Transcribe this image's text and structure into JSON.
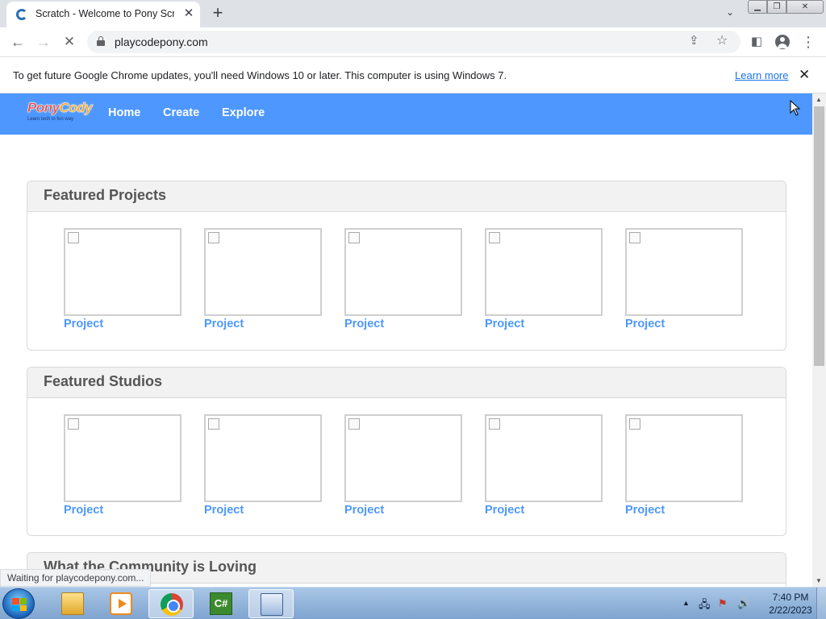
{
  "browser": {
    "tab_title": "Scratch - Welcome to Pony Scrat",
    "url": "playcodepony.com",
    "infobar_text": "To get future Google Chrome updates, you'll need Windows 10 or later. This computer is using Windows 7.",
    "infobar_link": "Learn more",
    "status_text": "Waiting for playcodepony.com..."
  },
  "site": {
    "logo_primary": "Pony",
    "logo_secondary": "Cody",
    "logo_tagline": "Learn tech in fun way",
    "nav": [
      "Home",
      "Create",
      "Explore"
    ]
  },
  "sections": [
    {
      "title": "Featured Projects",
      "items": [
        "Project",
        "Project",
        "Project",
        "Project",
        "Project"
      ]
    },
    {
      "title": "Featured Studios",
      "items": [
        "Project",
        "Project",
        "Project",
        "Project",
        "Project"
      ]
    },
    {
      "title": "What the Community is Loving",
      "items": []
    }
  ],
  "taskbar": {
    "time": "7:40 PM",
    "date": "2/22/2023",
    "apps": [
      "windows-explorer",
      "media-player",
      "google-chrome",
      "csharp-editor",
      "on-screen-keyboard"
    ]
  }
}
